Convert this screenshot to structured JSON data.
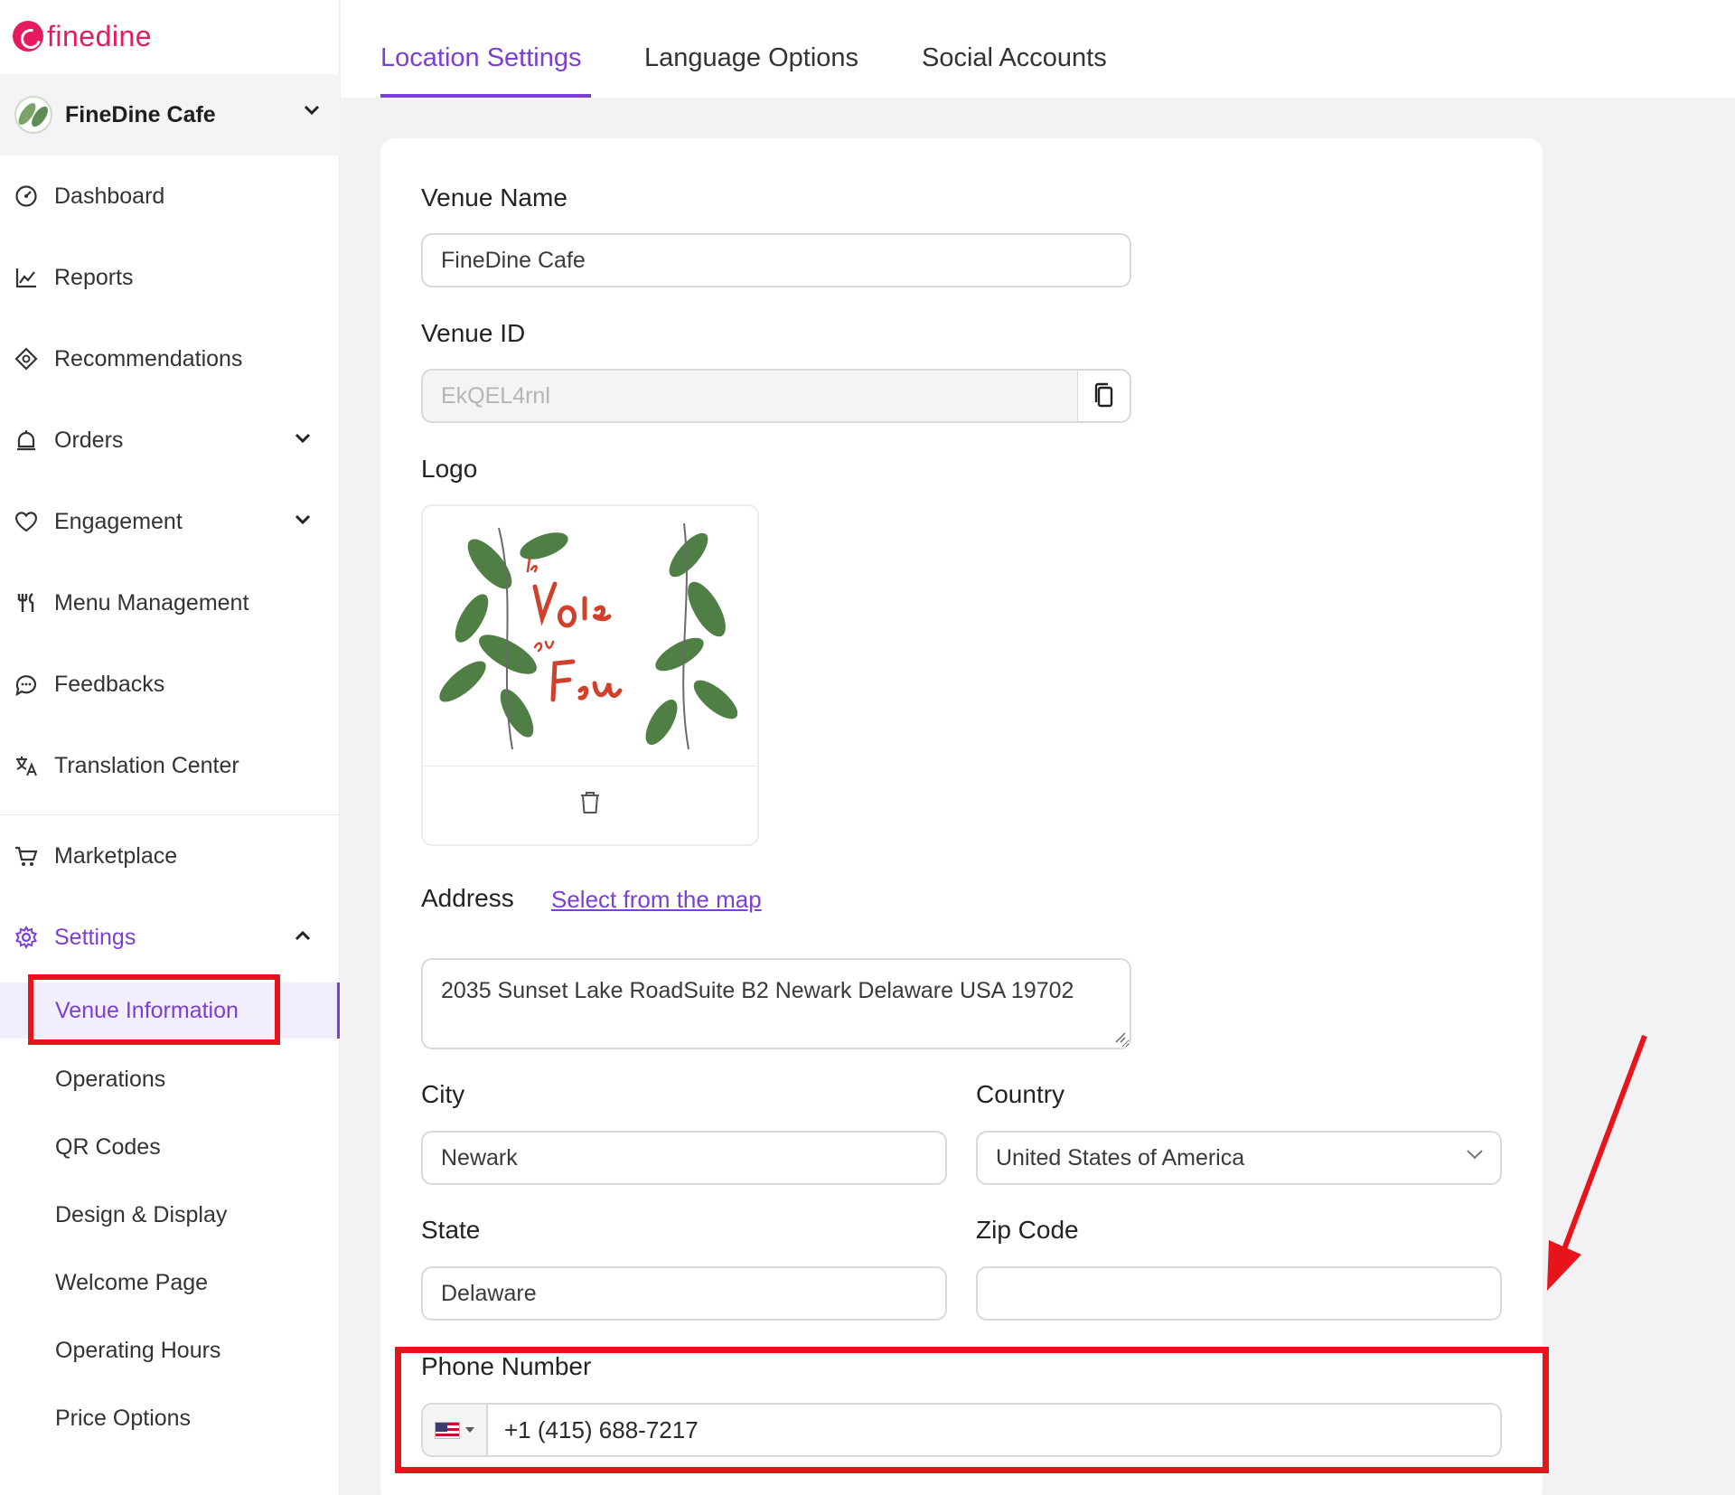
{
  "brand": {
    "name": "finedine"
  },
  "venue_switcher": {
    "name": "FineDine Cafe"
  },
  "sidebar": {
    "items": [
      {
        "label": "Dashboard",
        "icon": "dashboard-icon"
      },
      {
        "label": "Reports",
        "icon": "chart-line-icon"
      },
      {
        "label": "Recommendations",
        "icon": "recommendations-icon"
      },
      {
        "label": "Orders",
        "icon": "bell-icon"
      },
      {
        "label": "Engagement",
        "icon": "heart-icon"
      },
      {
        "label": "Menu Management",
        "icon": "fork-knife-icon"
      },
      {
        "label": "Feedbacks",
        "icon": "chat-icon"
      },
      {
        "label": "Translation Center",
        "icon": "translate-icon"
      },
      {
        "label": "Marketplace",
        "icon": "cart-icon"
      },
      {
        "label": "Settings",
        "icon": "gear-icon"
      }
    ],
    "settings_sub": [
      {
        "label": "Venue Information"
      },
      {
        "label": "Operations"
      },
      {
        "label": "QR Codes"
      },
      {
        "label": "Design & Display"
      },
      {
        "label": "Welcome Page"
      },
      {
        "label": "Operating Hours"
      },
      {
        "label": "Price Options"
      }
    ]
  },
  "tabs": [
    {
      "label": "Location Settings"
    },
    {
      "label": "Language Options"
    },
    {
      "label": "Social Accounts"
    }
  ],
  "form": {
    "venue_name": {
      "label": "Venue Name",
      "value": "FineDine Cafe"
    },
    "venue_id": {
      "label": "Venue ID",
      "value": "EkQEL4rnl"
    },
    "logo": {
      "label": "Logo"
    },
    "address": {
      "label": "Address",
      "link": "Select from the map",
      "value": "2035 Sunset Lake RoadSuite B2 Newark Delaware USA 19702"
    },
    "city": {
      "label": "City",
      "value": "Newark"
    },
    "country": {
      "label": "Country",
      "value": "United States of America"
    },
    "state": {
      "label": "State",
      "value": "Delaware"
    },
    "zip": {
      "label": "Zip Code",
      "value": ""
    },
    "phone": {
      "label": "Phone Number",
      "value": "+1 (415) 688-7217"
    }
  },
  "colors": {
    "accent": "#7b3fd3",
    "brand": "#e31c5f",
    "highlight": "#e8141b"
  }
}
